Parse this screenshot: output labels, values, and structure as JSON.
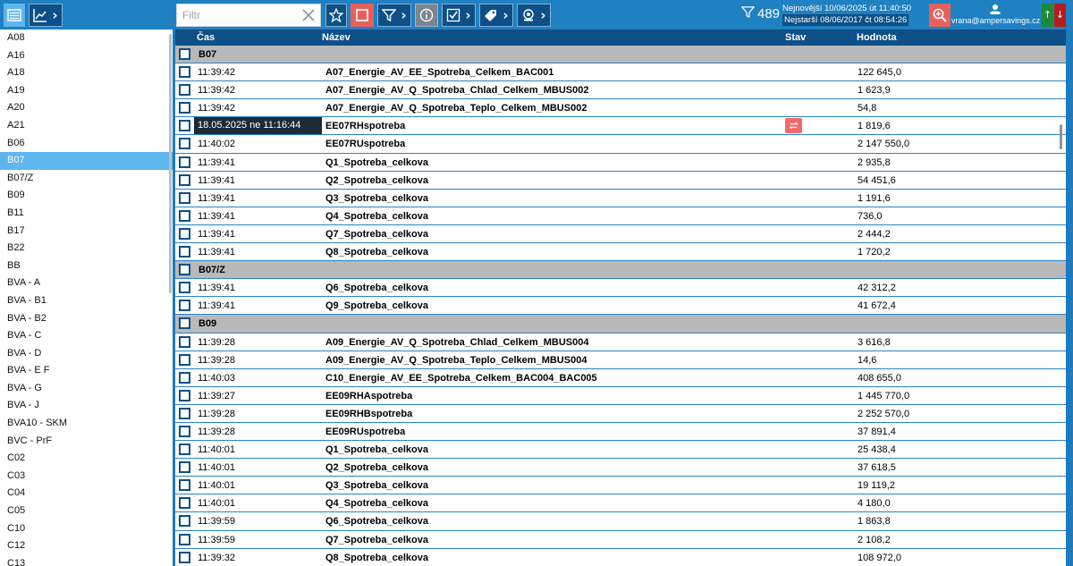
{
  "toolbar": {
    "filter_placeholder": "Filtr",
    "count": "489",
    "newest": "Nejnovější 10/06/2025 út 11:40:50",
    "oldest": "Nejstarší   08/06/2017 čt 08:54:26",
    "user_email": "vrana@ampersavings.cz",
    "icons": [
      "list-icon",
      "chart-icon",
      "star-icon",
      "select-icon",
      "filter-icon",
      "info-icon",
      "checkbox-icon",
      "tag-icon",
      "alarm-icon",
      "zoom-icon",
      "user-icon"
    ]
  },
  "colors": {
    "accent": "#1f80c2",
    "dark": "#0d4f86",
    "active_sidebar": "#5db6ef",
    "group_row": "#b9b9b9",
    "alert": "#e8605c"
  },
  "sidebar": {
    "items": [
      "A08",
      "A16",
      "A18",
      "A19",
      "A20",
      "A21",
      "B06",
      "B07",
      "B07/Z",
      "B09",
      "B11",
      "B17",
      "B22",
      "BB",
      "BVA - A",
      "BVA - B1",
      "BVA - B2",
      "BVA - C",
      "BVA - D",
      "BVA - E F",
      "BVA - G",
      "BVA - J",
      "BVA10 - SKM",
      "BVC - PrF",
      "C02",
      "C03",
      "C04",
      "C05",
      "C10",
      "C12",
      "C13"
    ],
    "active": "B07"
  },
  "table": {
    "columns": {
      "time": "Čas",
      "name": "Název",
      "status": "Stav",
      "value": "Hodnota"
    },
    "rows": [
      {
        "group": "B07"
      },
      {
        "time": "11:39:42",
        "name": "A07_Energie_AV_EE_Spotreba_Celkem_BAC001",
        "value": "122 645,0"
      },
      {
        "time": "11:39:42",
        "name": "A07_Energie_AV_Q_Spotreba_Chlad_Celkem_MBUS002",
        "value": "1 623,9"
      },
      {
        "time": "11:39:42",
        "name": "A07_Energie_AV_Q_Spotreba_Teplo_Celkem_MBUS002",
        "value": "54,8"
      },
      {
        "time": "18.05.2025 ne 11:16:44",
        "name": "EE07RHspotreba",
        "value": "1 819,6",
        "highlight": true,
        "status_icon": "swap-icon"
      },
      {
        "time": "11:40:02",
        "name": "EE07RUspotreba",
        "value": "2 147 550,0"
      },
      {
        "time": "11:39:41",
        "name": "Q1_Spotreba_celkova",
        "value": "2 935,8"
      },
      {
        "time": "11:39:41",
        "name": "Q2_Spotreba_celkova",
        "value": "54 451,6"
      },
      {
        "time": "11:39:41",
        "name": "Q3_Spotreba_celkova",
        "value": "1 191,6"
      },
      {
        "time": "11:39:41",
        "name": "Q4_Spotreba_celkova",
        "value": "736,0"
      },
      {
        "time": "11:39:41",
        "name": "Q7_Spotreba_celkova",
        "value": "2 444,2"
      },
      {
        "time": "11:39:41",
        "name": "Q8_Spotreba_celkova",
        "value": "1 720,2"
      },
      {
        "group": "B07/Z"
      },
      {
        "time": "11:39:41",
        "name": "Q6_Spotreba_celkova",
        "value": "42 312,2"
      },
      {
        "time": "11:39:41",
        "name": "Q9_Spotreba_celkova",
        "value": "41 672,4"
      },
      {
        "group": "B09"
      },
      {
        "time": "11:39:28",
        "name": "A09_Energie_AV_Q_Spotreba_Chlad_Celkem_MBUS004",
        "value": "3 616,8"
      },
      {
        "time": "11:39:28",
        "name": "A09_Energie_AV_Q_Spotreba_Teplo_Celkem_MBUS004",
        "value": "14,6"
      },
      {
        "time": "11:40:03",
        "name": "C10_Energie_AV_EE_Spotreba_Celkem_BAC004_BAC005",
        "value": "408 655,0"
      },
      {
        "time": "11:39:27",
        "name": "EE09RHAspotreba",
        "value": "1 445 770,0"
      },
      {
        "time": "11:39:28",
        "name": "EE09RHBspotreba",
        "value": "2 252 570,0"
      },
      {
        "time": "11:39:28",
        "name": "EE09RUspotreba",
        "value": "37 891,4"
      },
      {
        "time": "11:40:01",
        "name": "Q1_Spotreba_celkova",
        "value": "25 438,4"
      },
      {
        "time": "11:40:01",
        "name": "Q2_Spotreba_celkova",
        "value": "37 618,5"
      },
      {
        "time": "11:40:01",
        "name": "Q3_Spotreba_celkova",
        "value": "19 119,2"
      },
      {
        "time": "11:40:01",
        "name": "Q4_Spotreba_celkova",
        "value": "4 180,0"
      },
      {
        "time": "11:39:59",
        "name": "Q6_Spotreba_celkova",
        "value": "1 863,8"
      },
      {
        "time": "11:39:59",
        "name": "Q7_Spotreba_celkova",
        "value": "2 108,2"
      },
      {
        "time": "11:39:32",
        "name": "Q8_Spotreba_celkova",
        "value": "108 972,0"
      }
    ]
  }
}
